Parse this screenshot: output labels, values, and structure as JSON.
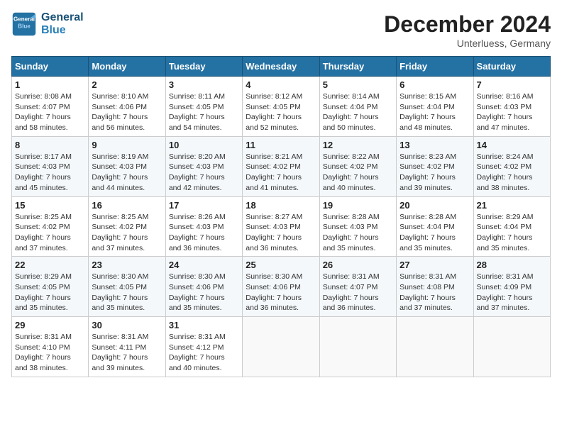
{
  "header": {
    "logo_line1": "General",
    "logo_line2": "Blue",
    "month": "December 2024",
    "location": "Unterluess, Germany"
  },
  "days_of_week": [
    "Sunday",
    "Monday",
    "Tuesday",
    "Wednesday",
    "Thursday",
    "Friday",
    "Saturday"
  ],
  "weeks": [
    [
      {
        "day": "1",
        "info": "Sunrise: 8:08 AM\nSunset: 4:07 PM\nDaylight: 7 hours\nand 58 minutes."
      },
      {
        "day": "2",
        "info": "Sunrise: 8:10 AM\nSunset: 4:06 PM\nDaylight: 7 hours\nand 56 minutes."
      },
      {
        "day": "3",
        "info": "Sunrise: 8:11 AM\nSunset: 4:05 PM\nDaylight: 7 hours\nand 54 minutes."
      },
      {
        "day": "4",
        "info": "Sunrise: 8:12 AM\nSunset: 4:05 PM\nDaylight: 7 hours\nand 52 minutes."
      },
      {
        "day": "5",
        "info": "Sunrise: 8:14 AM\nSunset: 4:04 PM\nDaylight: 7 hours\nand 50 minutes."
      },
      {
        "day": "6",
        "info": "Sunrise: 8:15 AM\nSunset: 4:04 PM\nDaylight: 7 hours\nand 48 minutes."
      },
      {
        "day": "7",
        "info": "Sunrise: 8:16 AM\nSunset: 4:03 PM\nDaylight: 7 hours\nand 47 minutes."
      }
    ],
    [
      {
        "day": "8",
        "info": "Sunrise: 8:17 AM\nSunset: 4:03 PM\nDaylight: 7 hours\nand 45 minutes."
      },
      {
        "day": "9",
        "info": "Sunrise: 8:19 AM\nSunset: 4:03 PM\nDaylight: 7 hours\nand 44 minutes."
      },
      {
        "day": "10",
        "info": "Sunrise: 8:20 AM\nSunset: 4:03 PM\nDaylight: 7 hours\nand 42 minutes."
      },
      {
        "day": "11",
        "info": "Sunrise: 8:21 AM\nSunset: 4:02 PM\nDaylight: 7 hours\nand 41 minutes."
      },
      {
        "day": "12",
        "info": "Sunrise: 8:22 AM\nSunset: 4:02 PM\nDaylight: 7 hours\nand 40 minutes."
      },
      {
        "day": "13",
        "info": "Sunrise: 8:23 AM\nSunset: 4:02 PM\nDaylight: 7 hours\nand 39 minutes."
      },
      {
        "day": "14",
        "info": "Sunrise: 8:24 AM\nSunset: 4:02 PM\nDaylight: 7 hours\nand 38 minutes."
      }
    ],
    [
      {
        "day": "15",
        "info": "Sunrise: 8:25 AM\nSunset: 4:02 PM\nDaylight: 7 hours\nand 37 minutes."
      },
      {
        "day": "16",
        "info": "Sunrise: 8:25 AM\nSunset: 4:02 PM\nDaylight: 7 hours\nand 37 minutes."
      },
      {
        "day": "17",
        "info": "Sunrise: 8:26 AM\nSunset: 4:03 PM\nDaylight: 7 hours\nand 36 minutes."
      },
      {
        "day": "18",
        "info": "Sunrise: 8:27 AM\nSunset: 4:03 PM\nDaylight: 7 hours\nand 36 minutes."
      },
      {
        "day": "19",
        "info": "Sunrise: 8:28 AM\nSunset: 4:03 PM\nDaylight: 7 hours\nand 35 minutes."
      },
      {
        "day": "20",
        "info": "Sunrise: 8:28 AM\nSunset: 4:04 PM\nDaylight: 7 hours\nand 35 minutes."
      },
      {
        "day": "21",
        "info": "Sunrise: 8:29 AM\nSunset: 4:04 PM\nDaylight: 7 hours\nand 35 minutes."
      }
    ],
    [
      {
        "day": "22",
        "info": "Sunrise: 8:29 AM\nSunset: 4:05 PM\nDaylight: 7 hours\nand 35 minutes."
      },
      {
        "day": "23",
        "info": "Sunrise: 8:30 AM\nSunset: 4:05 PM\nDaylight: 7 hours\nand 35 minutes."
      },
      {
        "day": "24",
        "info": "Sunrise: 8:30 AM\nSunset: 4:06 PM\nDaylight: 7 hours\nand 35 minutes."
      },
      {
        "day": "25",
        "info": "Sunrise: 8:30 AM\nSunset: 4:06 PM\nDaylight: 7 hours\nand 36 minutes."
      },
      {
        "day": "26",
        "info": "Sunrise: 8:31 AM\nSunset: 4:07 PM\nDaylight: 7 hours\nand 36 minutes."
      },
      {
        "day": "27",
        "info": "Sunrise: 8:31 AM\nSunset: 4:08 PM\nDaylight: 7 hours\nand 37 minutes."
      },
      {
        "day": "28",
        "info": "Sunrise: 8:31 AM\nSunset: 4:09 PM\nDaylight: 7 hours\nand 37 minutes."
      }
    ],
    [
      {
        "day": "29",
        "info": "Sunrise: 8:31 AM\nSunset: 4:10 PM\nDaylight: 7 hours\nand 38 minutes."
      },
      {
        "day": "30",
        "info": "Sunrise: 8:31 AM\nSunset: 4:11 PM\nDaylight: 7 hours\nand 39 minutes."
      },
      {
        "day": "31",
        "info": "Sunrise: 8:31 AM\nSunset: 4:12 PM\nDaylight: 7 hours\nand 40 minutes."
      },
      {
        "day": "",
        "info": ""
      },
      {
        "day": "",
        "info": ""
      },
      {
        "day": "",
        "info": ""
      },
      {
        "day": "",
        "info": ""
      }
    ]
  ]
}
